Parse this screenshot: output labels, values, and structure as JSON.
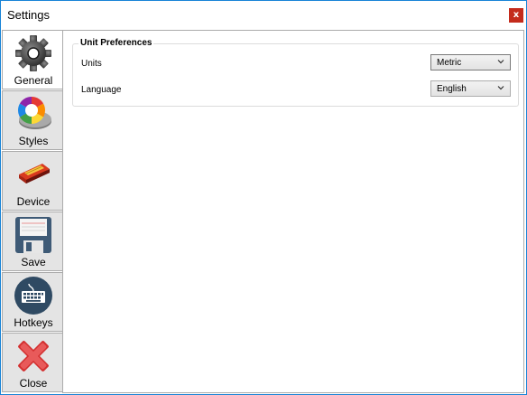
{
  "window": {
    "title": "Settings",
    "close_glyph": "x"
  },
  "nav": {
    "items": [
      {
        "label": "General",
        "icon": "gear-icon",
        "active": true
      },
      {
        "label": "Styles",
        "icon": "color-wheel-icon",
        "active": false
      },
      {
        "label": "Device",
        "icon": "device-icon",
        "active": false
      },
      {
        "label": "Save",
        "icon": "floppy-disk-icon",
        "active": false
      },
      {
        "label": "Hotkeys",
        "icon": "keyboard-icon",
        "active": false
      },
      {
        "label": "Close",
        "icon": "red-x-icon",
        "active": false
      }
    ]
  },
  "unit_preferences": {
    "legend": "Unit Preferences",
    "units": {
      "label": "Units",
      "value": "Metric"
    },
    "language": {
      "label": "Language",
      "value": "English"
    }
  },
  "colors": {
    "window_border": "#1883d7",
    "close_button": "#c42b1c",
    "nav_background": "#e4e4e4"
  }
}
